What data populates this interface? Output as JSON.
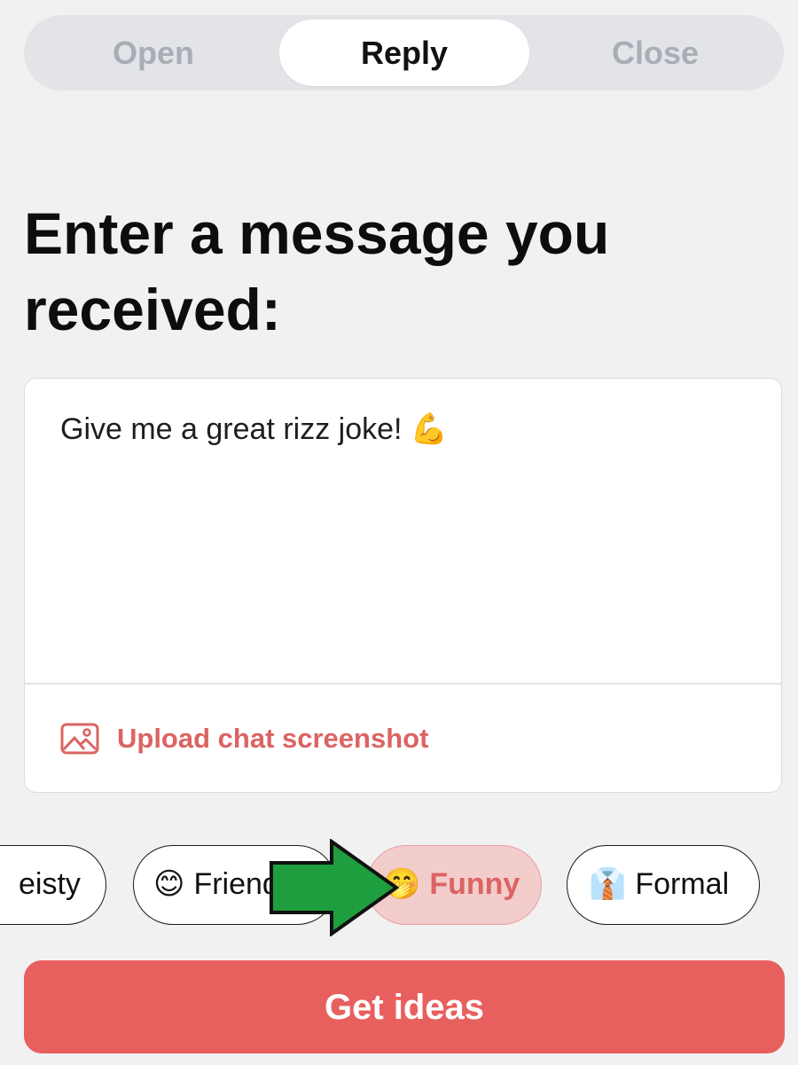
{
  "tabs": [
    {
      "label": "Open",
      "active": false
    },
    {
      "label": "Reply",
      "active": true
    },
    {
      "label": "Close",
      "active": false
    }
  ],
  "heading": "Enter a message you received:",
  "message": {
    "value": "Give me a great rizz joke! 💪"
  },
  "upload": {
    "label": "Upload chat screenshot",
    "icon": "image-icon"
  },
  "chips": [
    {
      "label": "Feisty",
      "visible_text": "eisty",
      "emoji": ""
    },
    {
      "label": "Friendly",
      "visible_text": "Friendly",
      "emoji": "😊"
    },
    {
      "label": "Funny",
      "visible_text": "Funny",
      "emoji": "🤭",
      "selected": true
    },
    {
      "label": "Formal",
      "visible_text": "Formal",
      "emoji": "👔"
    }
  ],
  "cta": {
    "label": "Get ideas"
  },
  "colors": {
    "accent": "#e8605e",
    "accent_text": "#db6462",
    "selected_chip_bg": "#f3cccc",
    "arrow": "#1e9e3e"
  }
}
